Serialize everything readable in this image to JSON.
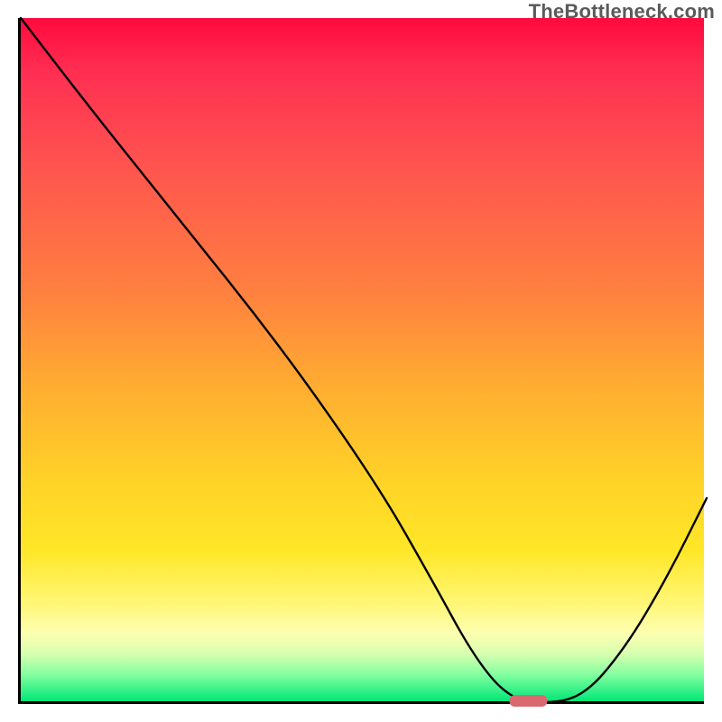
{
  "watermark": "TheBottleneck.com",
  "chart_data": {
    "type": "line",
    "title": "",
    "xlabel": "",
    "ylabel": "",
    "xlim": [
      0,
      100
    ],
    "ylim": [
      0,
      100
    ],
    "grid": false,
    "legend": false,
    "background": "rainbow-gradient-red-to-green",
    "series": [
      {
        "name": "bottleneck-curve",
        "x": [
          0,
          10,
          22,
          38,
          52,
          60,
          66,
          71,
          76,
          82,
          88,
          94,
          100
        ],
        "y": [
          100,
          87,
          72,
          52,
          32,
          18,
          7,
          1,
          0,
          1,
          8,
          18,
          30
        ]
      }
    ],
    "annotations": [
      {
        "name": "optimal-marker",
        "type": "pill",
        "x": 74,
        "y": 0,
        "color": "#d86a6f"
      }
    ]
  }
}
